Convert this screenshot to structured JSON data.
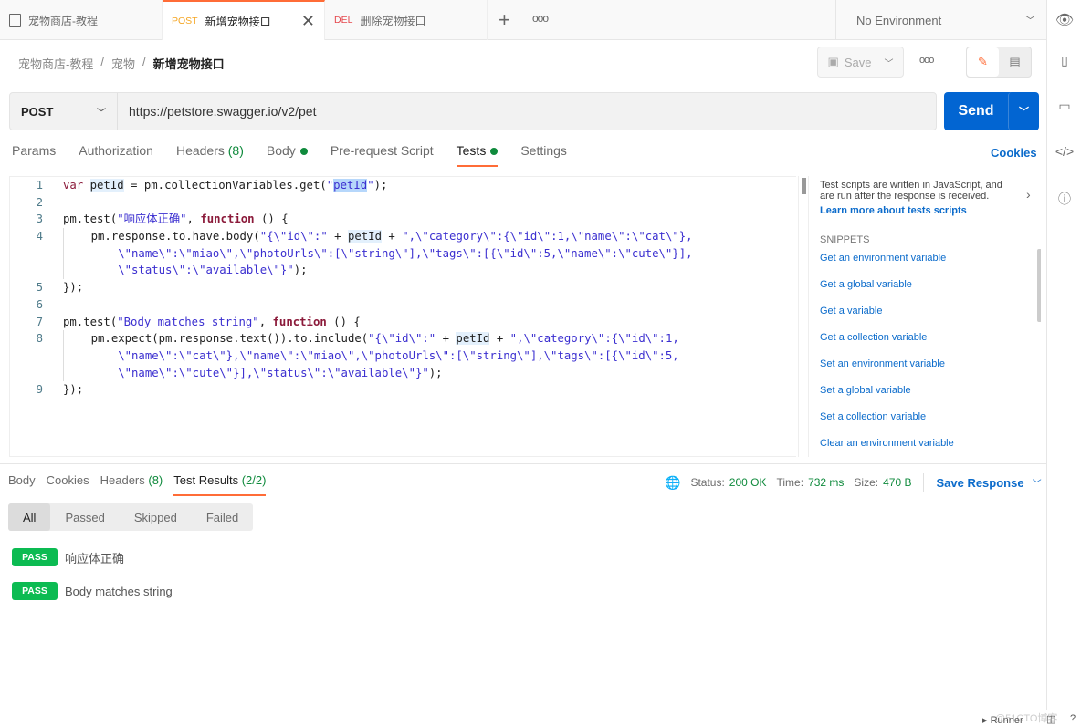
{
  "tabs": [
    {
      "label": "宠物商店-教程",
      "icon": "document-icon"
    },
    {
      "method": "POST",
      "label": "新增宠物接口",
      "active": true
    },
    {
      "method": "DEL",
      "label": "删除宠物接口"
    }
  ],
  "environment": "No Environment",
  "breadcrumb": [
    "宠物商店-教程",
    "宠物",
    "新增宠物接口"
  ],
  "save_label": "Save",
  "request": {
    "method": "POST",
    "url": "https://petstore.swagger.io/v2/pet",
    "send": "Send"
  },
  "request_tabs": {
    "params": "Params",
    "authorization": "Authorization",
    "headers": "Headers",
    "headers_count": "(8)",
    "body": "Body",
    "prerequest": "Pre-request Script",
    "tests": "Tests",
    "settings": "Settings",
    "cookies": "Cookies"
  },
  "code_rows": [
    {
      "n": "1",
      "type": "code",
      "segs": [
        [
          "var ",
          "k"
        ],
        [
          "petId",
          "hl"
        ],
        [
          " = pm.collectionVariables.get(",
          ""
        ],
        [
          "\"",
          "s"
        ],
        [
          "petId",
          "s hl2"
        ],
        [
          "\"",
          "s"
        ],
        [
          ");",
          ""
        ]
      ]
    },
    {
      "n": "2",
      "type": "code",
      "segs": []
    },
    {
      "n": "3",
      "type": "code",
      "segs": [
        [
          "pm.test(",
          ""
        ],
        [
          "\"响应体正确\"",
          "s"
        ],
        [
          ", ",
          ""
        ],
        [
          "function",
          "kb"
        ],
        [
          " () {",
          ""
        ]
      ]
    },
    {
      "n": "4",
      "type": "ind",
      "segs": [
        [
          "    pm.response.to.have.body(",
          ""
        ],
        [
          "\"{\\\"id\\\":\"",
          "s"
        ],
        [
          " + ",
          ""
        ],
        [
          "petId",
          "hl"
        ],
        [
          " + ",
          ""
        ],
        [
          "\",\\\"category\\\":{\\\"id\\\":1,\\\"name\\\":\\\"cat\\\"},",
          "s"
        ]
      ]
    },
    {
      "n": "",
      "type": "ind",
      "segs": [
        [
          "        \\\"name\\\":\\\"miao\\\",\\\"photoUrls\\\":[\\\"string\\\"],\\\"tags\\\":[{\\\"id\\\":5,\\\"name\\\":\\\"cute\\\"}],",
          "s"
        ]
      ]
    },
    {
      "n": "",
      "type": "ind",
      "segs": [
        [
          "        \\\"status\\\":\\\"available\\\"}\"",
          "s"
        ],
        [
          ");",
          ""
        ]
      ]
    },
    {
      "n": "5",
      "type": "code",
      "segs": [
        [
          "});",
          ""
        ]
      ]
    },
    {
      "n": "6",
      "type": "code",
      "segs": []
    },
    {
      "n": "7",
      "type": "code",
      "segs": [
        [
          "pm.test(",
          ""
        ],
        [
          "\"Body matches string\"",
          "s"
        ],
        [
          ", ",
          ""
        ],
        [
          "function",
          "kb"
        ],
        [
          " () {",
          ""
        ]
      ]
    },
    {
      "n": "8",
      "type": "ind",
      "segs": [
        [
          "    pm.expect(pm.response.text()).to.include(",
          ""
        ],
        [
          "\"{\\\"id\\\":\"",
          "s"
        ],
        [
          " + ",
          ""
        ],
        [
          "petId",
          "hl"
        ],
        [
          " + ",
          ""
        ],
        [
          "\",\\\"category\\\":{\\\"id\\\":1,",
          "s"
        ]
      ]
    },
    {
      "n": "",
      "type": "ind",
      "segs": [
        [
          "        \\\"name\\\":\\\"cat\\\"},\\\"name\\\":\\\"miao\\\",\\\"photoUrls\\\":[\\\"string\\\"],\\\"tags\\\":[{\\\"id\\\":5,",
          "s"
        ]
      ]
    },
    {
      "n": "",
      "type": "ind",
      "segs": [
        [
          "        \\\"name\\\":\\\"cute\\\"}],\\\"status\\\":\\\"available\\\"}\"",
          "s"
        ],
        [
          ");",
          ""
        ]
      ]
    },
    {
      "n": "9",
      "type": "code",
      "segs": [
        [
          "});",
          ""
        ]
      ]
    }
  ],
  "sidebar": {
    "description": "Test scripts are written in JavaScript, and are run after the response is received.",
    "learn_more": "Learn more about tests scripts",
    "snippets_title": "SNIPPETS",
    "snippets": [
      "Get an environment variable",
      "Get a global variable",
      "Get a variable",
      "Get a collection variable",
      "Set an environment variable",
      "Set a global variable",
      "Set a collection variable",
      "Clear an environment variable"
    ]
  },
  "response_tabs": {
    "body": "Body",
    "cookies": "Cookies",
    "headers": "Headers",
    "headers_count": "(8)",
    "test_results": "Test Results",
    "test_count": "(2/2)"
  },
  "response_meta": {
    "status_label": "Status:",
    "status": "200 OK",
    "time_label": "Time:",
    "time": "732 ms",
    "size_label": "Size:",
    "size": "470 B",
    "save_response": "Save Response"
  },
  "filters": [
    "All",
    "Passed",
    "Skipped",
    "Failed"
  ],
  "results": [
    {
      "badge": "PASS",
      "name": "响应体正确"
    },
    {
      "badge": "PASS",
      "name": "Body matches string"
    }
  ],
  "footer": {
    "runner": "Runner",
    "watermark": "@51CTO博客"
  },
  "colors": {
    "accent": "#ff6c37",
    "send": "#0265d2",
    "pass": "#0cbb52",
    "post": "#f5a623",
    "del": "#e5484d"
  }
}
